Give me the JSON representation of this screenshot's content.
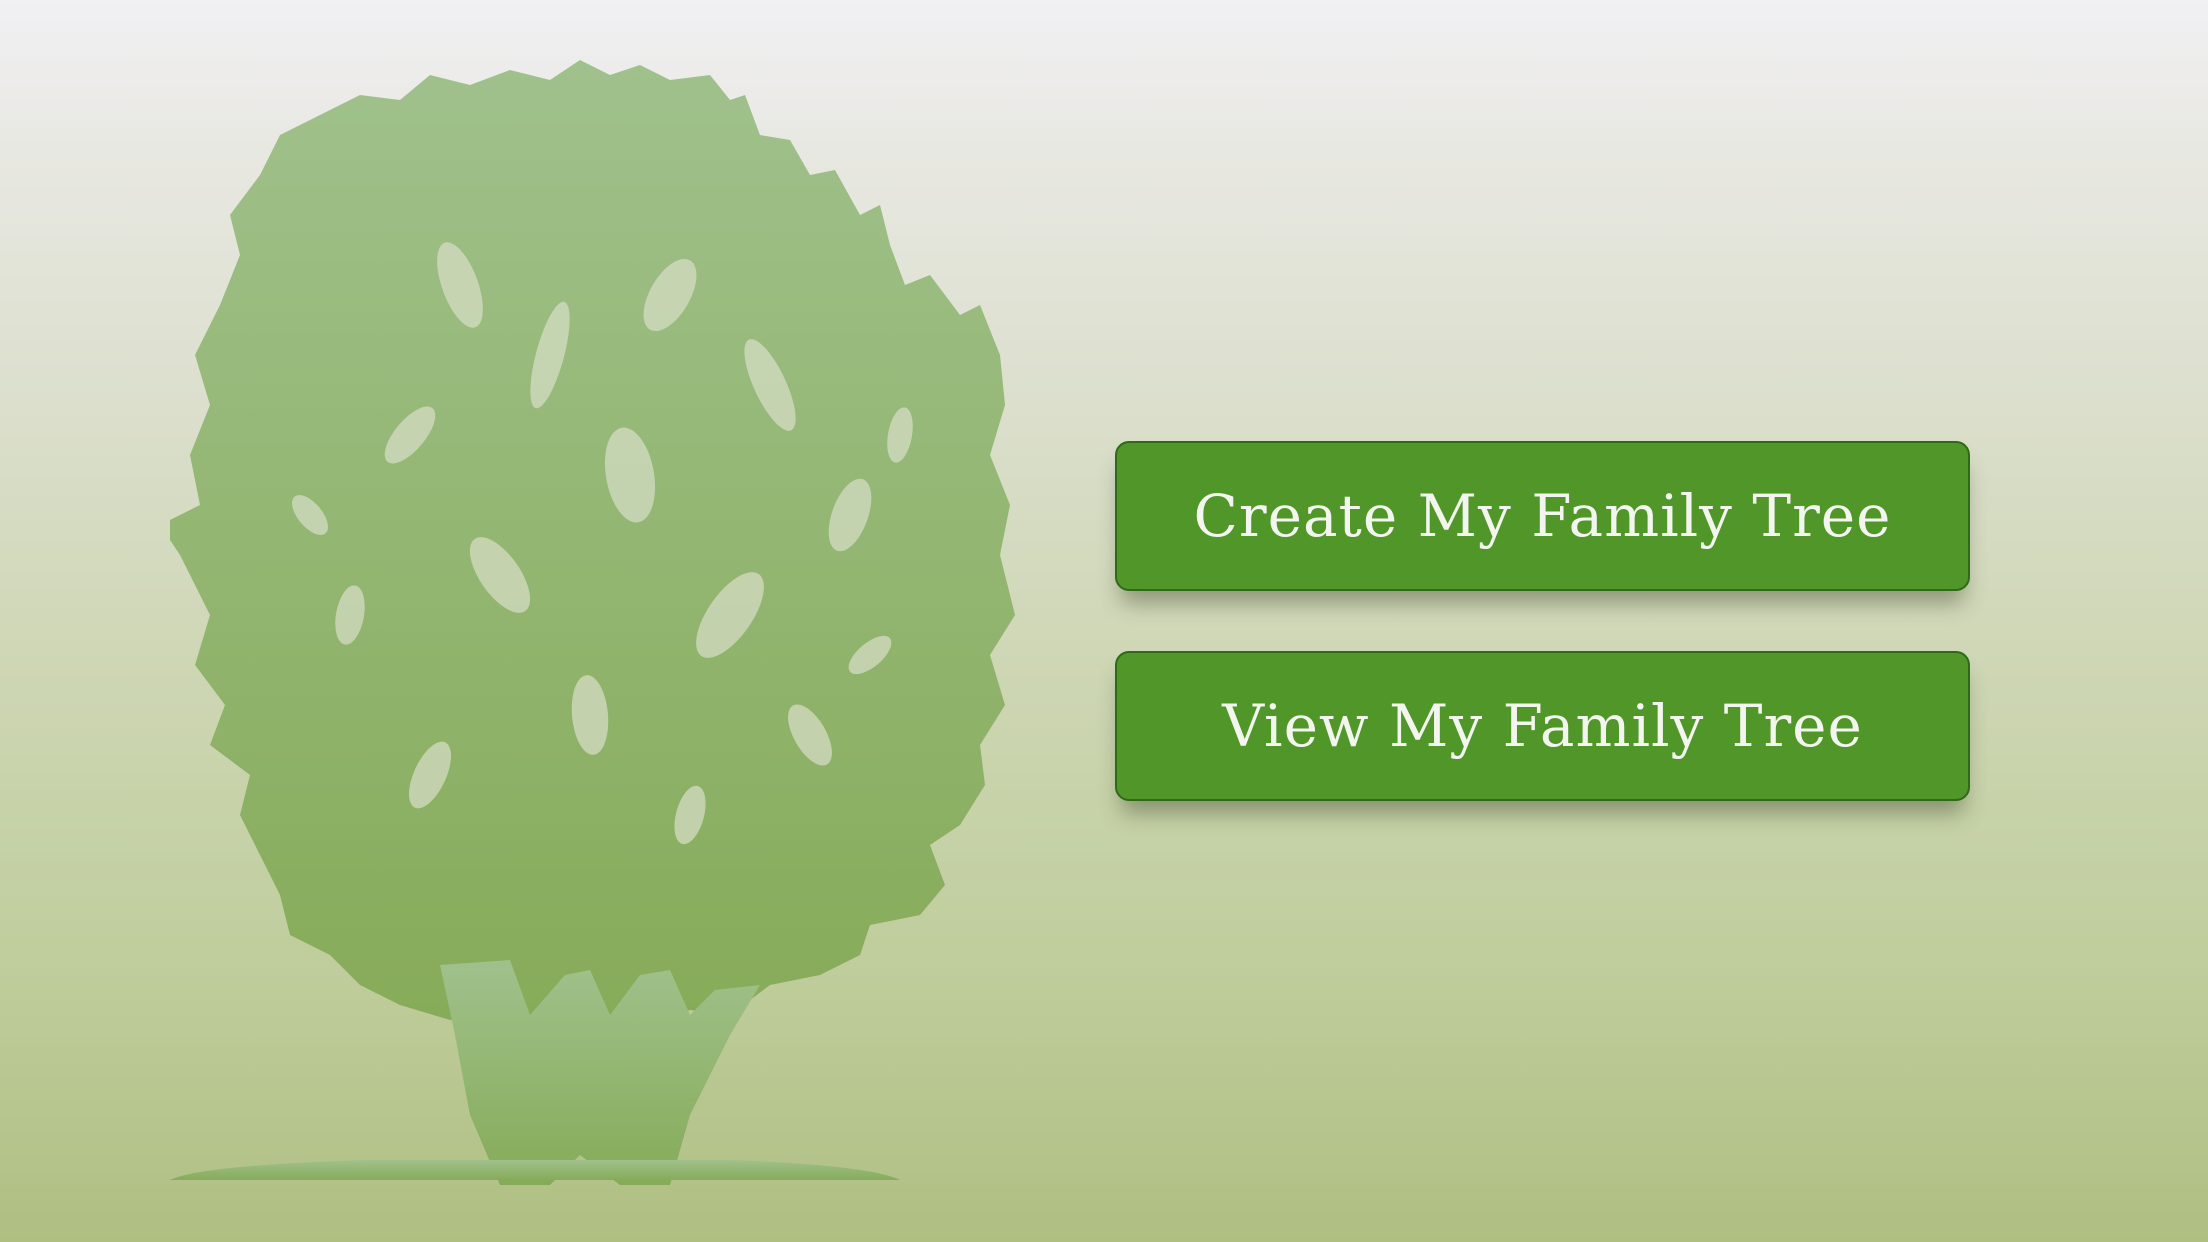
{
  "theme": {
    "button_color": "#519629",
    "button_border": "#2f6a18",
    "button_text_color": "#f3f6ee",
    "tree_color_top": "#a0c18c",
    "tree_color_bottom": "#86ab58"
  },
  "illustration": {
    "icon": "tree-silhouette-icon"
  },
  "actions": {
    "create_label": "Create My Family Tree",
    "view_label": "View My Family Tree"
  }
}
